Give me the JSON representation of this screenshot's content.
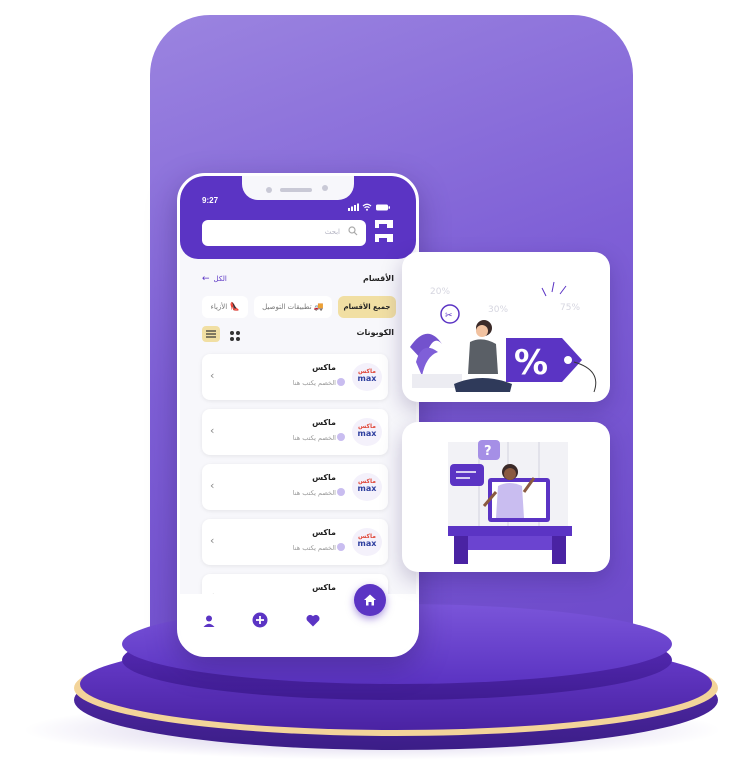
{
  "status_bar": {
    "time": "9:27"
  },
  "search": {
    "placeholder": "ابحث"
  },
  "logo": {
    "text": "مم"
  },
  "sections": {
    "title": "الأقسام",
    "all_link": "الكل"
  },
  "chips": [
    {
      "label": "جميع الأقسام",
      "active": true
    },
    {
      "label": "تطبيقات التوصيل",
      "active": false
    },
    {
      "label": "الأزياء",
      "active": false
    }
  ],
  "coupons": {
    "title": "الكوبونات"
  },
  "coupon_cards": [
    {
      "name": "ماكس",
      "desc": "الخصم يكتب هنا",
      "brand_ar": "ماكس",
      "brand_en": "max"
    },
    {
      "name": "ماكس",
      "desc": "الخصم يكتب هنا",
      "brand_ar": "ماكس",
      "brand_en": "max"
    },
    {
      "name": "ماكس",
      "desc": "الخصم يكتب هنا",
      "brand_ar": "ماكس",
      "brand_en": "max"
    },
    {
      "name": "ماكس",
      "desc": "الخصم يكتب هنا",
      "brand_ar": "ماكس",
      "brand_en": "max"
    },
    {
      "name": "ماكس",
      "desc": "",
      "brand_ar": "",
      "brand_en": ""
    }
  ],
  "bottom_nav": {
    "icons": [
      "user-icon",
      "plus-icon",
      "heart-icon",
      "home-icon"
    ]
  },
  "illustrations": {
    "discount": {
      "percent_sign": "%",
      "tags": [
        "20%",
        "30%",
        "75%"
      ]
    },
    "support": {
      "question": "?"
    }
  },
  "colors": {
    "primary": "#5b34c4",
    "accent": "#f1dfa3",
    "background_panel": "#8a6ad9"
  }
}
